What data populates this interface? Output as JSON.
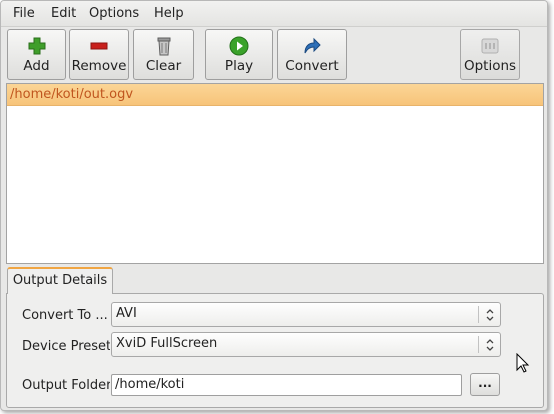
{
  "menu": {
    "items": [
      "File",
      "Edit",
      "Options",
      "Help"
    ]
  },
  "toolbar": {
    "add_label": "Add",
    "remove_label": "Remove",
    "clear_label": "Clear",
    "play_label": "Play",
    "convert_label": "Convert",
    "options_label": "Options"
  },
  "file_list": {
    "items": [
      "/home/koti/out.ogv"
    ]
  },
  "tabs": {
    "output_details_label": "Output Details"
  },
  "form": {
    "convert_to_label": "Convert To ...",
    "convert_to_value": "AVI",
    "device_preset_label": "Device Preset",
    "device_preset_value": "XviD FullScreen",
    "output_folder_label": "Output Folder",
    "output_folder_value": "/home/koti",
    "browse_label": "..."
  },
  "colors": {
    "selection": "#f7c47a",
    "selection_text": "#c0561f",
    "tab_accent": "#f0a542",
    "add_icon": "#3f9e2a",
    "remove_icon": "#c8201c",
    "play_icon": "#3aa22a",
    "convert_icon": "#2d6fb8"
  }
}
